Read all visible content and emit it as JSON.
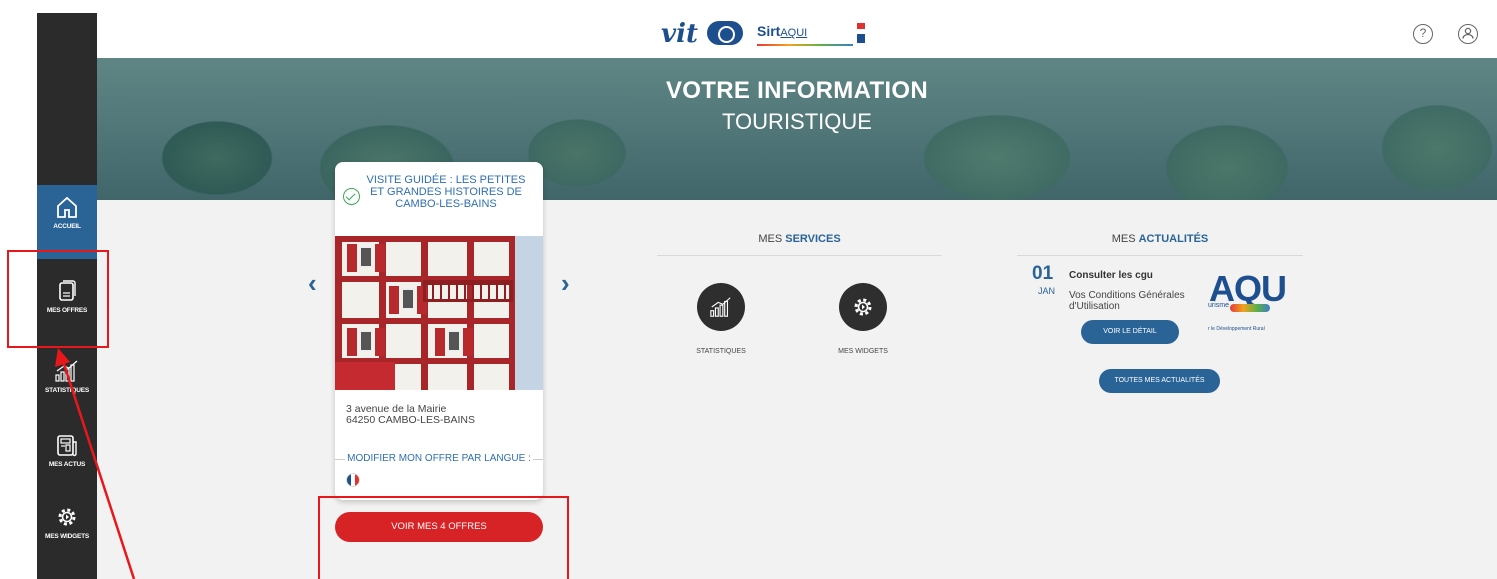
{
  "sidebar": {
    "items": [
      {
        "label": "ACCUEIL",
        "icon": "home-icon"
      },
      {
        "label": "MES OFFRES",
        "icon": "offers-icon"
      },
      {
        "label": "STATISTIQUES",
        "icon": "statistics-icon"
      },
      {
        "label": "MES ACTUS",
        "icon": "news-icon"
      },
      {
        "label": "MES WIDGETS",
        "icon": "widgets-icon"
      }
    ]
  },
  "header": {
    "logo_vit": "vit",
    "logo_sirtaqui": "Sirt",
    "logo_sirtaqui_sub": "AQUI",
    "help_icon": "help-icon",
    "account_icon": "account-icon"
  },
  "banner": {
    "title": "VOTRE INFORMATION",
    "subtitle": "TOURISTIQUE"
  },
  "offer": {
    "title": "VISITE GUIDÉE : LES PETITES ET GRANDES HISTOIRES DE CAMBO-LES-BAINS",
    "address_line1": "3 avenue de la Mairie",
    "address_line2": "64250 CAMBO-LES-BAINS",
    "modify_label": "MODIFIER MON OFFRE PAR LANGUE :",
    "prev_arrow": "‹",
    "next_arrow": "›",
    "see_all_button": "VOIR MES 4 OFFRES"
  },
  "services": {
    "title_prefix": "MES ",
    "title_bold": "SERVICES",
    "items": [
      {
        "label": "STATISTIQUES",
        "icon": "statistics-icon"
      },
      {
        "label": "MES WIDGETS",
        "icon": "widgets-icon"
      }
    ]
  },
  "news": {
    "title_prefix": "MES ",
    "title_bold": "ACTUALITÉS",
    "day": "01",
    "month": "JAN",
    "item_title": "Consulter les cgu",
    "item_desc": "Vos Conditions Générales d'Utilisation",
    "detail_button": "VOIR LE DÉTAIL",
    "all_button": "TOUTES MES ACTUALITÉS",
    "logo_text": "AQU",
    "logo_tour": "urisme",
    "logo_dev": "r le Développement Rural"
  },
  "colors": {
    "primary": "#2a6496",
    "sidebar": "#2b2b2b",
    "accent_red": "#d72326",
    "annotation": "#e8171c"
  }
}
